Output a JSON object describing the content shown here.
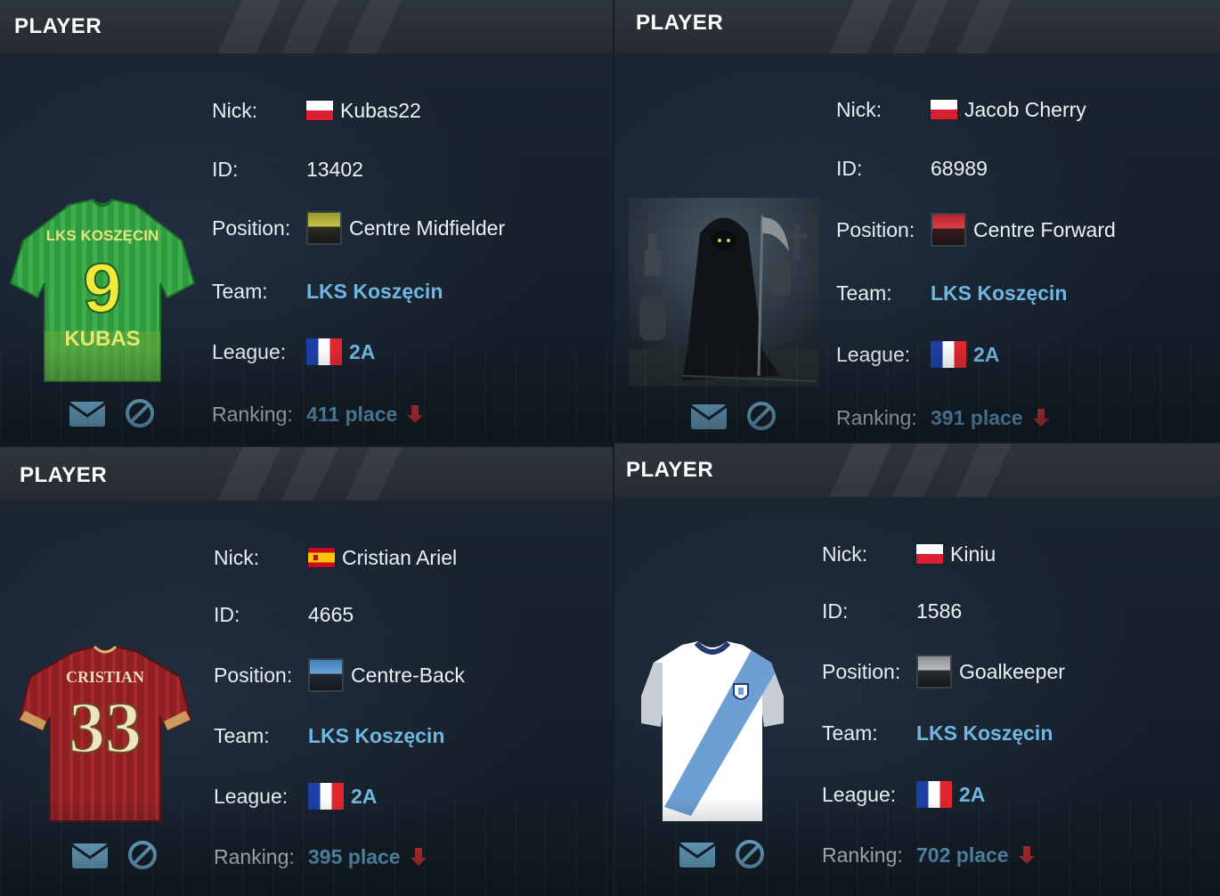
{
  "colors": {
    "accent_link": "#6fb7e0",
    "ranking_down": "#e03434",
    "header_bg": "#2b3036",
    "panel_bg": "#18222d"
  },
  "cards": [
    {
      "title": "PLAYER",
      "visual": "green-yellow-jersey",
      "jersey_text": {
        "name": "LKS KOSZĘCIN",
        "number": "9",
        "back": "KUBAS"
      },
      "labels": {
        "nick": "Nick:",
        "id": "ID:",
        "position": "Position:",
        "team": "Team:",
        "league": "League:",
        "ranking": "Ranking:"
      },
      "nick": "Kubas22",
      "nick_flag": "poland-flag-icon",
      "id": "13402",
      "position": "Centre Midfielder",
      "position_icon": "midfielder-badge-icon",
      "team": "LKS Koszęcin",
      "league": "2A",
      "league_flag": "france-flag-icon",
      "ranking": "411 place",
      "ranking_trend": "down"
    },
    {
      "title": "PLAYER",
      "visual": "grim-reaper-avatar",
      "labels": {
        "nick": "Nick:",
        "id": "ID:",
        "position": "Position:",
        "team": "Team:",
        "league": "League:",
        "ranking": "Ranking:"
      },
      "nick": "Jacob Cherry",
      "nick_flag": "poland-flag-icon",
      "id": "68989",
      "position": "Centre Forward",
      "position_icon": "forward-badge-icon",
      "team": "LKS Koszęcin",
      "league": "2A",
      "league_flag": "france-flag-icon",
      "ranking": "391 place",
      "ranking_trend": "down"
    },
    {
      "title": "PLAYER",
      "visual": "red-jersey",
      "jersey_text": {
        "name": "CRISTIAN",
        "number": "33"
      },
      "labels": {
        "nick": "Nick:",
        "id": "ID:",
        "position": "Position:",
        "team": "Team:",
        "league": "League:",
        "ranking": "Ranking:"
      },
      "nick": "Cristian Ariel",
      "nick_flag": "spain-flag-icon",
      "id": "4665",
      "position": "Centre-Back",
      "position_icon": "defender-badge-icon",
      "team": "LKS Koszęcin",
      "league": "2A",
      "league_flag": "france-flag-icon",
      "ranking": "395 place",
      "ranking_trend": "down"
    },
    {
      "title": "PLAYER",
      "visual": "white-blue-sash-jersey",
      "labels": {
        "nick": "Nick:",
        "id": "ID:",
        "position": "Position:",
        "team": "Team:",
        "league": "League:",
        "ranking": "Ranking:"
      },
      "nick": "Kiniu",
      "nick_flag": "poland-flag-icon",
      "id": "1586",
      "position": "Goalkeeper",
      "position_icon": "goalkeeper-badge-icon",
      "team": "LKS Koszęcin",
      "league": "2A",
      "league_flag": "france-flag-icon",
      "ranking": "702 place",
      "ranking_trend": "down"
    }
  ]
}
